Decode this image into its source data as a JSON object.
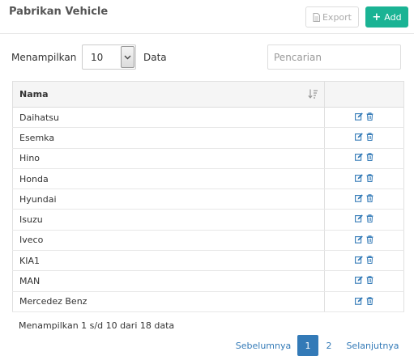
{
  "header": {
    "title": "Pabrikan Vehicle",
    "export_label": "Export",
    "add_label": "Add"
  },
  "controls": {
    "show_label": "Menampilkan",
    "page_size": "10",
    "data_label": "Data",
    "search_placeholder": "Pencarian"
  },
  "table": {
    "columns": [
      "Nama",
      ""
    ],
    "rows": [
      {
        "name": "Daihatsu"
      },
      {
        "name": "Esemka"
      },
      {
        "name": "Hino"
      },
      {
        "name": "Honda"
      },
      {
        "name": "Hyundai"
      },
      {
        "name": "Isuzu"
      },
      {
        "name": "Iveco"
      },
      {
        "name": "KIA1"
      },
      {
        "name": "MAN"
      },
      {
        "name": "Mercedez Benz"
      }
    ]
  },
  "footer": {
    "info": "Menampilkan 1 s/d 10 dari 18 data",
    "prev": "Sebelumnya",
    "pages": [
      "1",
      "2"
    ],
    "next": "Selanjutnya"
  },
  "colors": {
    "add_button": "#1ab394",
    "link": "#337ab7",
    "active_page": "#337ab7"
  },
  "icons": {
    "export": "file-icon",
    "add": "plus-icon",
    "sort": "sort-amount-icon",
    "edit": "edit-icon",
    "delete": "trash-icon"
  }
}
